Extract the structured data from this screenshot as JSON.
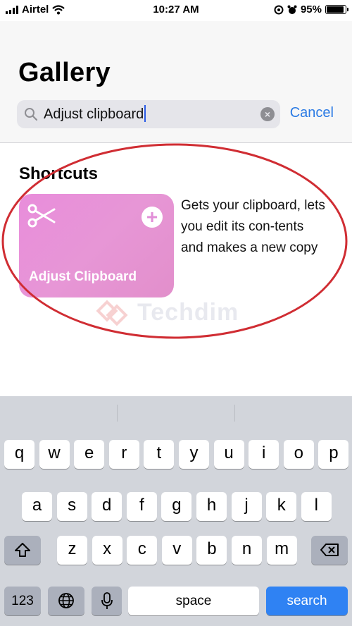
{
  "status": {
    "carrier": "Airtel",
    "time": "10:27 AM",
    "battery": "95%",
    "battery_level": 0.95
  },
  "header": {
    "title": "Gallery",
    "search_value": "Adjust clipboard",
    "cancel_label": "Cancel"
  },
  "section": {
    "title": "Shortcuts"
  },
  "card": {
    "name": "Adjust Clipboard",
    "description": "Gets your clipboard, lets you edit its con-tents and makes a new copy",
    "color": "#e88ddb"
  },
  "watermark": {
    "text": "Techdim"
  },
  "keyboard": {
    "row1": [
      "q",
      "w",
      "e",
      "r",
      "t",
      "y",
      "u",
      "i",
      "o",
      "p"
    ],
    "row2": [
      "a",
      "s",
      "d",
      "f",
      "g",
      "h",
      "j",
      "k",
      "l"
    ],
    "row3": [
      "z",
      "x",
      "c",
      "v",
      "b",
      "n",
      "m"
    ],
    "numbers_label": "123",
    "space_label": "space",
    "search_label": "search"
  }
}
